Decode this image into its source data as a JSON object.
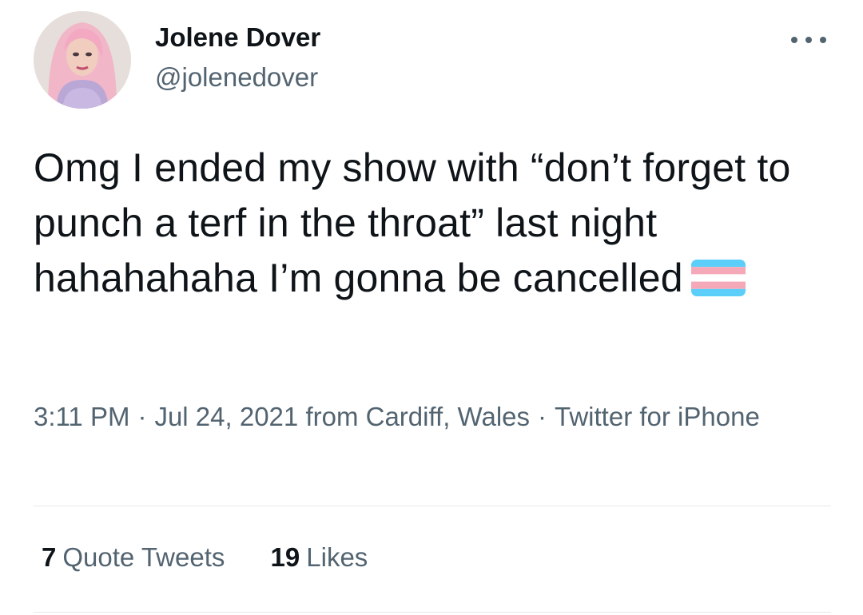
{
  "author": {
    "display_name": "Jolene Dover",
    "handle": "@jolenedover",
    "avatar_icon": "profile-photo"
  },
  "tweet": {
    "text": "Omg I ended my show with “don’t forget to punch a terf in the throat” last night hahahahaha I’m gonna be cancelled",
    "emoji": "transgender-flag-emoji",
    "time": "3:11 PM",
    "date": "Jul 24, 2021",
    "location": "from Cardiff, Wales",
    "source": "Twitter for iPhone",
    "separator": "·"
  },
  "stats": {
    "quote_tweets_count": "7",
    "quote_tweets_label": "Quote Tweets",
    "likes_count": "19",
    "likes_label": "Likes"
  },
  "colors": {
    "text_primary": "#0f1419",
    "text_secondary": "#536471",
    "divider": "#e7e9ea",
    "flag_blue": "#5bcefa",
    "flag_pink": "#f5a9b8",
    "flag_white": "#ffffff"
  }
}
